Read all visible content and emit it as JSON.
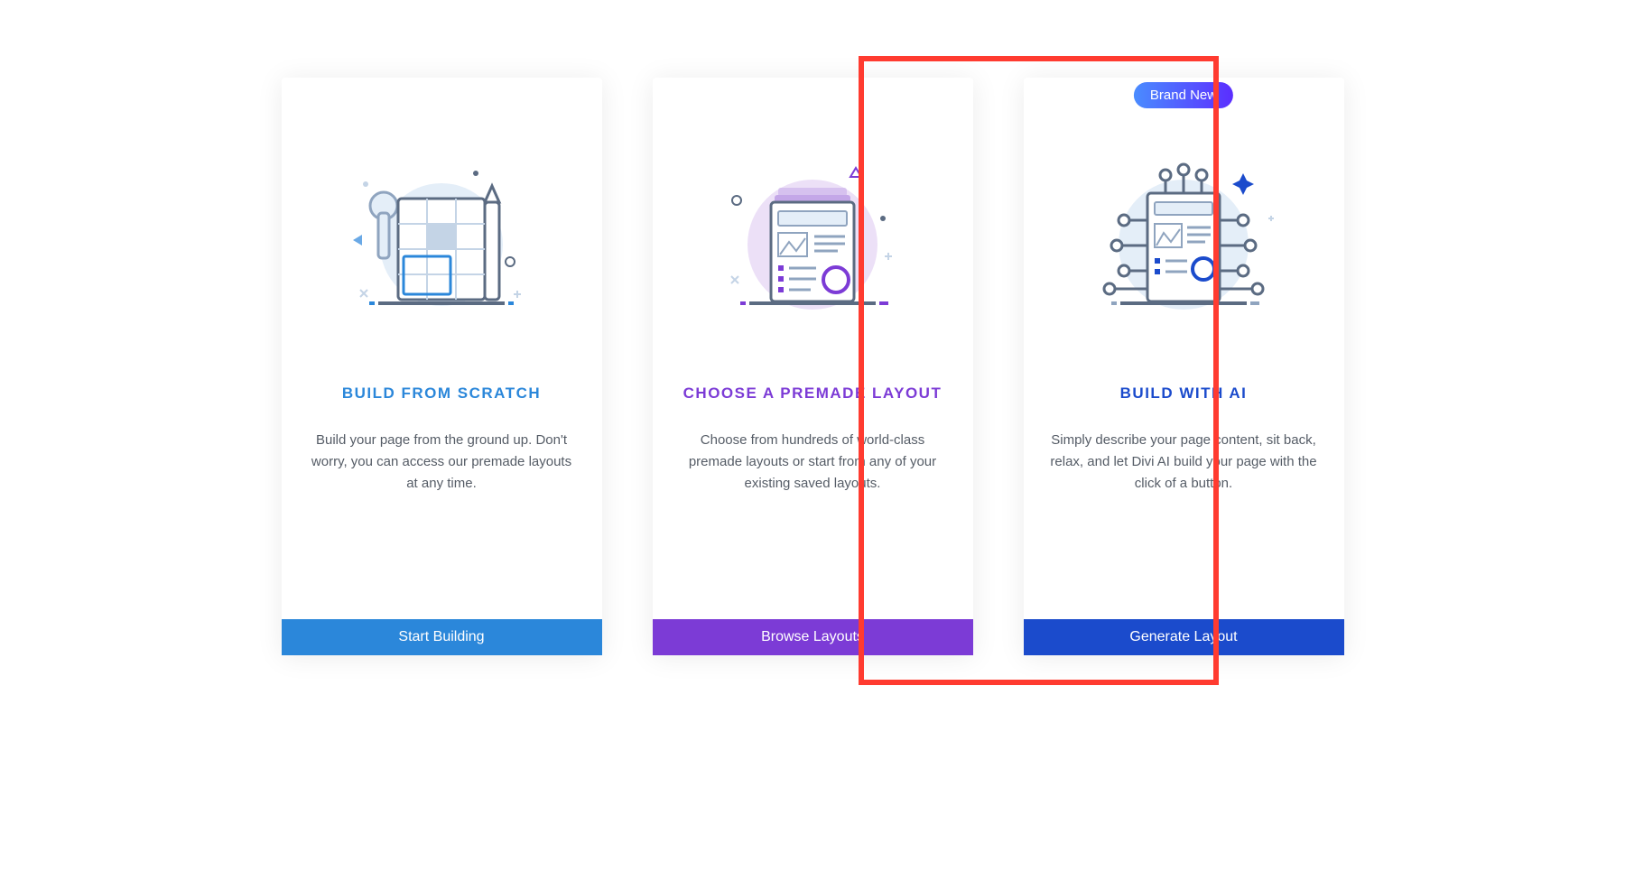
{
  "cards": [
    {
      "title": "BUILD FROM SCRATCH",
      "description": "Build your page from the ground up. Don't worry, you can access our premade layouts at any time.",
      "button": "Start Building"
    },
    {
      "title": "CHOOSE A PREMADE LAYOUT",
      "description": "Choose from hundreds of world-class premade layouts or start from any of your existing saved layouts.",
      "button": "Browse Layouts"
    },
    {
      "badge": "Brand New",
      "title": "BUILD WITH AI",
      "description": "Simply describe your page content, sit back, relax, and let Divi AI build your page with the click of a button.",
      "button": "Generate Layout"
    }
  ],
  "colors": {
    "card0_accent": "#2b87da",
    "card1_accent": "#7c3bd6",
    "card2_accent": "#1b4bcc",
    "highlight": "#ff3b30"
  }
}
